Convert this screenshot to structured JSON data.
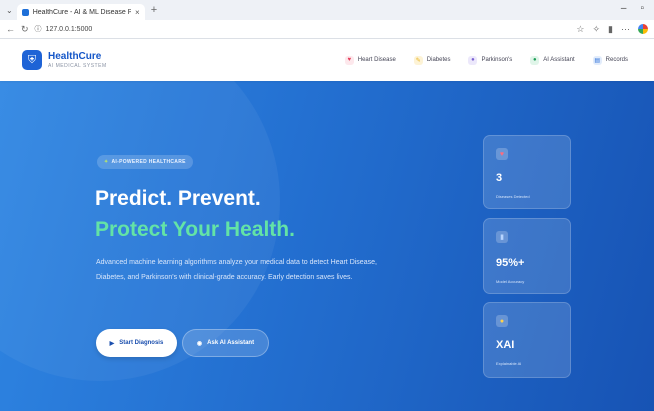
{
  "browser": {
    "tab_title": "HealthCure - AI & ML Disease Pr",
    "url": "127.0.0.1:5000"
  },
  "brand": {
    "name": "HealthCure",
    "subtitle": "AI MEDICAL SYSTEM"
  },
  "nav": {
    "items": [
      {
        "label": "Heart Disease",
        "icon": "heart-icon",
        "color": "#e53e5b",
        "bg": "#fde8ec"
      },
      {
        "label": "Diabetes",
        "icon": "drop-icon",
        "color": "#e8b21c",
        "bg": "#fdf3d6"
      },
      {
        "label": "Parkinson's",
        "icon": "brain-icon",
        "color": "#7b61d1",
        "bg": "#ece8fb"
      },
      {
        "label": "AI Assistant",
        "icon": "robot-icon",
        "color": "#1f9d58",
        "bg": "#e0f5e9"
      },
      {
        "label": "Records",
        "icon": "records-icon",
        "color": "#2b6fd8",
        "bg": "#e2ecfb"
      }
    ]
  },
  "hero": {
    "badge": "AI-POWERED HEALTHCARE",
    "title_line1": "Predict. Prevent.",
    "title_line2": "Protect Your Health.",
    "description": "Advanced machine learning algorithms analyze your medical data to detect Heart Disease, Diabetes, and Parkinson's with clinical-grade accuracy. Early detection saves lives.",
    "primary_button": "Start Diagnosis",
    "secondary_button": "Ask AI Assistant"
  },
  "stats": [
    {
      "value": "3",
      "label": "Diseases Detected",
      "icon": "heart-icon",
      "icon_color": "#ff6b7d"
    },
    {
      "value": "95%+",
      "label": "Model Accuracy",
      "icon": "chart-icon",
      "icon_color": "#b7d4ff"
    },
    {
      "value": "XAI",
      "label": "Explainable AI",
      "icon": "bulb-icon",
      "icon_color": "#ffd24a"
    }
  ],
  "accent_color": "#236fd0",
  "highlight_color": "#63e3a6"
}
